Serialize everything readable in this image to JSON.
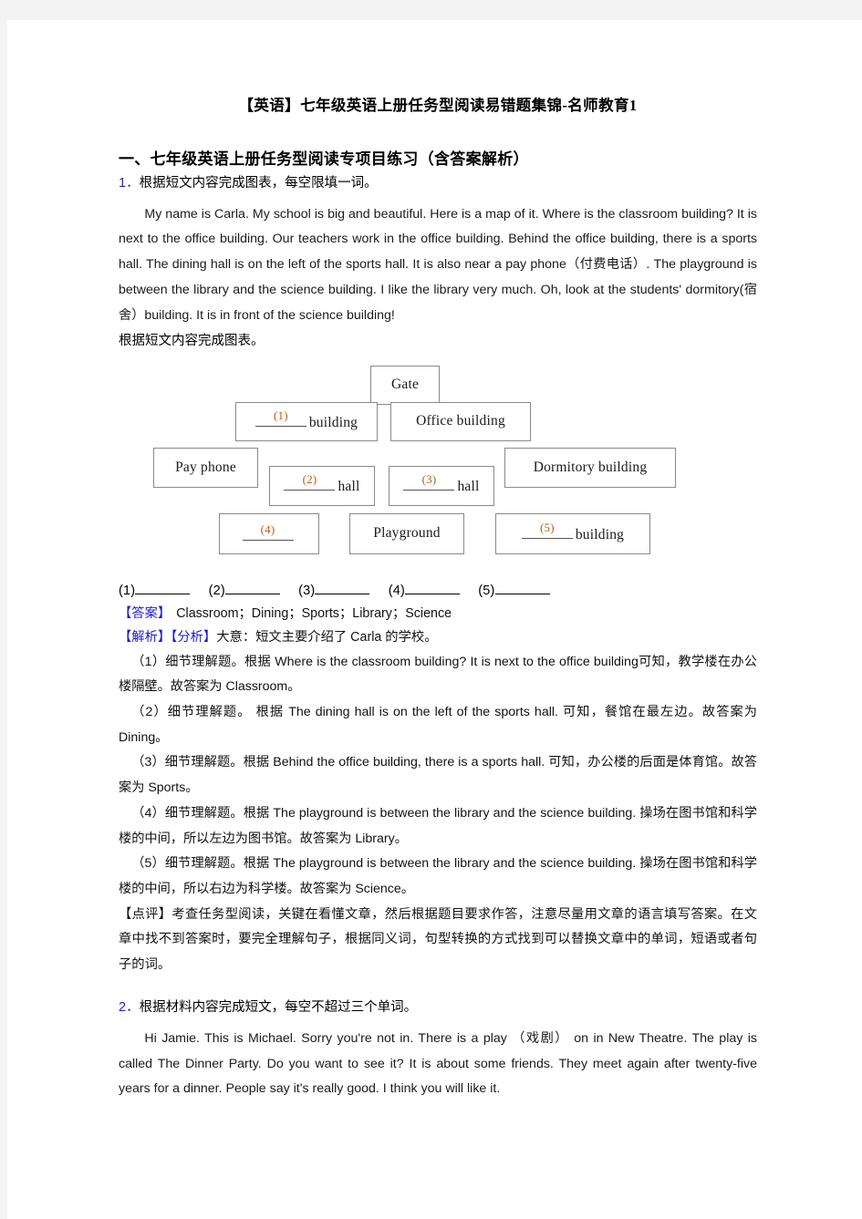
{
  "document": {
    "title": "【英语】七年级英语上册任务型阅读易错题集锦-名师教育1",
    "section_heading": "一、七年级英语上册任务型阅读专项目练习（含答案解析）"
  },
  "question1": {
    "number": "1．",
    "instruction": "根据短文内容完成图表，每空限填一词。",
    "passage": "My name is Carla. My school is big and beautiful. Here is a map of it. Where is the classroom building? It is next to the office building. Our teachers work in the office building. Behind the office building, there is a sports hall. The dining hall is on the left of the sports hall. It is also near a pay phone（付费电话）. The playground is between the library and the science building. I like the library very much. Oh, look at the students' dormitory(宿舍）building. It is in front of the science building!",
    "chart_prompt": "根据短文内容完成图表。",
    "diagram": {
      "gate": "Gate",
      "blank1_index": "(1)",
      "blank1_label": "building",
      "office": "Office building",
      "payphone": "Pay phone",
      "blank2_index": "(2)",
      "blank2_label": "hall",
      "blank3_index": "(3)",
      "blank3_label": "hall",
      "dormitory": "Dormitory building",
      "blank4_index": "(4)",
      "blank4_label": "",
      "playground": "Playground",
      "blank5_index": "(5)",
      "blank5_label": "building"
    },
    "fill_labels": [
      "(1)",
      "(2)",
      "(3)",
      "(4)",
      "(5)"
    ],
    "answer_tag": "【答案】",
    "answer_text": "Classroom；Dining；Sports；Library；Science",
    "analysis_tag": "【解析】",
    "analysis_sub_tag": "【分析】",
    "analysis_intro": "大意：短文主要介绍了 Carla 的学校。",
    "explanations": [
      "（1）细节理解题。根据 Where is the classroom building? It is next to the office building可知，教学楼在办公楼隔壁。故答案为 Classroom。",
      "（2）细节理解题。 根据 The dining hall is on the left of the sports hall. 可知，餐馆在最左边。故答案为 Dining。",
      "（3）细节理解题。根据 Behind the office building, there is a sports hall. 可知，办公楼的后面是体育馆。故答案为 Sports。",
      "（4）细节理解题。根据 The playground is between the library and the science building. 操场在图书馆和科学楼的中间，所以左边为图书馆。故答案为 Library。",
      "（5）细节理解题。根据 The playground is between the library and the science building. 操场在图书馆和科学楼的中间，所以右边为科学楼。故答案为 Science。"
    ],
    "comment_tag": "【点评】",
    "comment_text": "考查任务型阅读，关键在看懂文章，然后根据题目要求作答，注意尽量用文章的语言填写答案。在文章中找不到答案时，要完全理解句子，根据同义词，句型转换的方式找到可以替换文章中的单词，短语或者句子的词。"
  },
  "question2": {
    "number": "2．",
    "instruction": "根据材料内容完成短文，每空不超过三个单词。",
    "passage": "Hi Jamie. This is Michael. Sorry you're not in. There is a play （戏剧） on in New Theatre. The play is called The Dinner Party. Do you want to see it? It is about some friends. They meet again after twenty-five years for a dinner. People say it's really good. I think you will like it."
  },
  "colors": {
    "tag_blue": "#1a1ad0",
    "number_blue": "#2222cc",
    "blank_index_orange": "#c05a17",
    "box_border": "#8a8a8a",
    "page_bg": "#ffffff",
    "canvas_bg": "#f4f4f4"
  }
}
